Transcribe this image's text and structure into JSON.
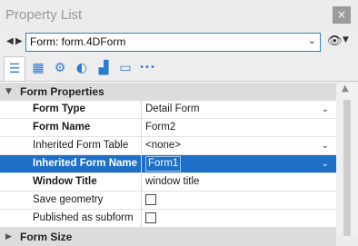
{
  "window": {
    "title": "Property List",
    "close_glyph": "×"
  },
  "nav": {
    "back_glyph": "◀",
    "forward_glyph": "▶"
  },
  "form_selector": {
    "value": "Form: form.4DForm",
    "chevron": "⌄"
  },
  "view": {
    "eye_glyph": "👁",
    "caret": "▼"
  },
  "tabs": [
    {
      "icon": "list-icon",
      "glyph": "☰",
      "active": true
    },
    {
      "icon": "calculator-icon",
      "glyph": "▦",
      "active": false
    },
    {
      "icon": "gear-icon",
      "glyph": "⚙",
      "active": false
    },
    {
      "icon": "shapes-icon",
      "glyph": "◐",
      "active": false
    },
    {
      "icon": "chart-icon",
      "glyph": "▟",
      "active": false
    },
    {
      "icon": "monitor-icon",
      "glyph": "▭",
      "active": false
    },
    {
      "icon": "more-icon",
      "glyph": "•••",
      "active": false
    }
  ],
  "groups": [
    {
      "label": "Form Properties",
      "expanded": true,
      "tri": "▼"
    },
    {
      "label": "Form Size",
      "expanded": false,
      "tri": "▶"
    }
  ],
  "properties": [
    {
      "label": "Form Type",
      "value": "Detail Form",
      "bold": true,
      "has_dropdown": true,
      "chevron": "⌄"
    },
    {
      "label": "Form Name",
      "value": "Form2",
      "bold": true,
      "has_dropdown": false
    },
    {
      "label": "Inherited Form Table",
      "value": "<none>",
      "bold": false,
      "has_dropdown": true,
      "chevron": "⌄"
    },
    {
      "label": "Inherited Form Name",
      "value": "Form1",
      "bold": true,
      "has_dropdown": true,
      "selected": true,
      "chevron": "⌄"
    },
    {
      "label": "Window Title",
      "value": "window title",
      "bold": true,
      "has_dropdown": false
    },
    {
      "label": "Save geometry",
      "value": "",
      "bold": false,
      "checkbox": true,
      "checked": false
    },
    {
      "label": "Published as subform",
      "value": "",
      "bold": false,
      "checkbox": true,
      "checked": false
    }
  ],
  "scrollbar": {
    "up_glyph": "▲"
  },
  "colors": {
    "selection": "#1e6fc7",
    "accent": "#2b7bd0",
    "close_bg": "#9b9b9b"
  }
}
